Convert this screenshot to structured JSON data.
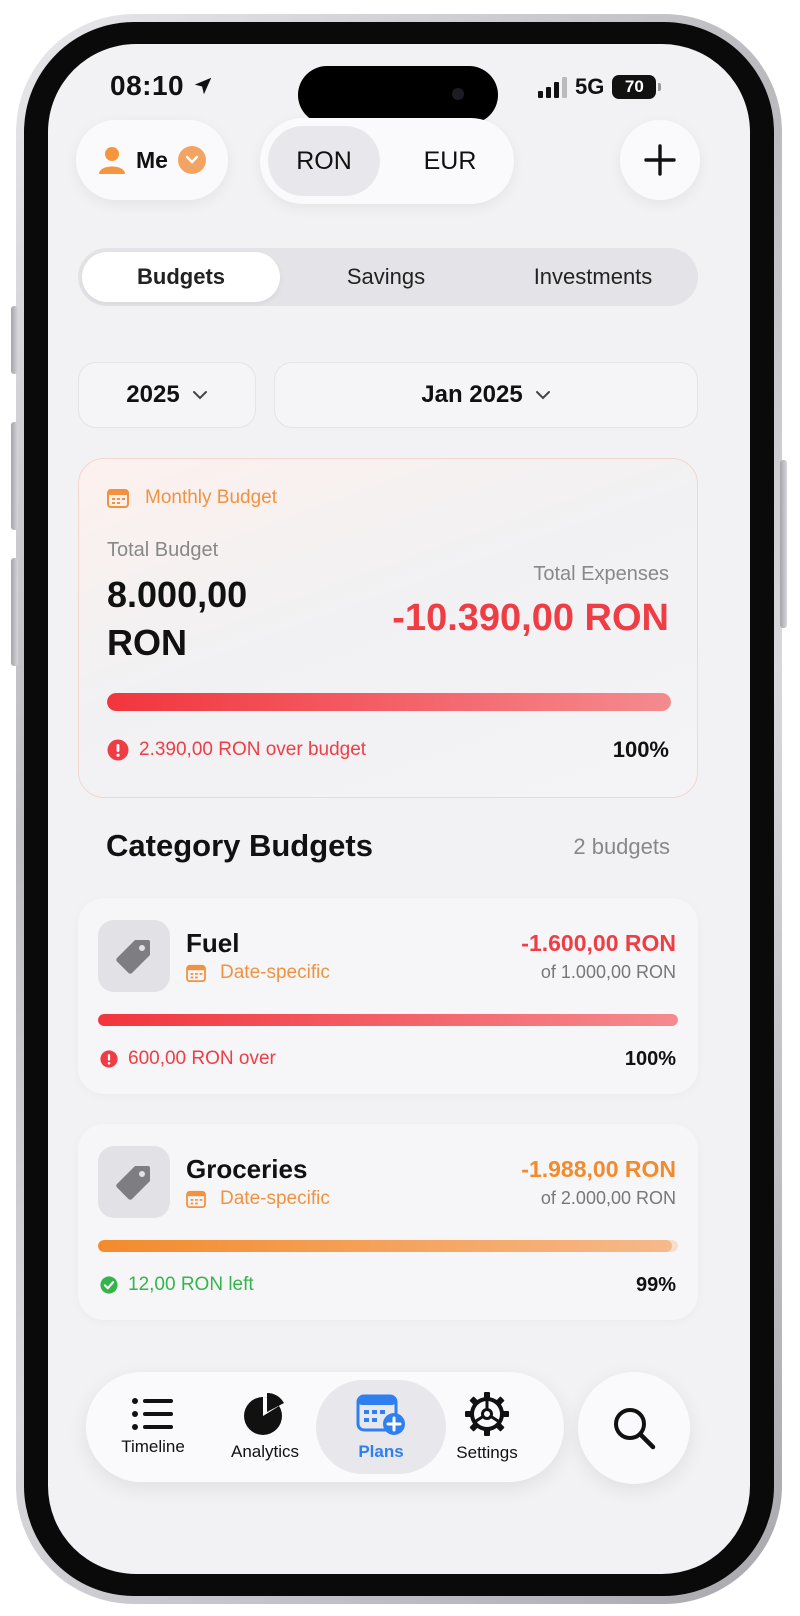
{
  "status_bar": {
    "time": "08:10",
    "network": "5G",
    "battery": "70"
  },
  "header": {
    "profile_label": "Me",
    "currencies": [
      "RON",
      "EUR"
    ],
    "selected_currency": "RON"
  },
  "tabs": [
    {
      "label": "Budgets",
      "active": true
    },
    {
      "label": "Savings",
      "active": false
    },
    {
      "label": "Investments",
      "active": false
    }
  ],
  "filters": {
    "year": "2025",
    "month": "Jan 2025"
  },
  "monthly_budget": {
    "title": "Monthly Budget",
    "total_budget_label": "Total Budget",
    "total_budget_line1": "8.000,00",
    "total_budget_line2": "RON",
    "total_expenses_label": "Total Expenses",
    "total_expenses": "-10.390,00 RON",
    "progress": 1.0,
    "status_text": "2.390,00 RON over budget",
    "percent": "100%"
  },
  "category_section": {
    "title": "Category Budgets",
    "count": "2 budgets"
  },
  "categories": [
    {
      "name": "Fuel",
      "type": "Date-specific",
      "spent": "-1.600,00 RON",
      "of": "of 1.000,00 RON",
      "progress": 1.0,
      "status_text": "600,00 RON over",
      "percent": "100%",
      "color": "#ef3d45",
      "status": "over"
    },
    {
      "name": "Groceries",
      "type": "Date-specific",
      "spent": "-1.988,00 RON",
      "of": "of 2.000,00 RON",
      "progress": 0.99,
      "status_text": "12,00 RON left",
      "percent": "99%",
      "color": "#f38b2c",
      "status": "ok"
    }
  ],
  "tab_bar": [
    {
      "label": "Timeline",
      "icon": "list-icon",
      "active": false
    },
    {
      "label": "Analytics",
      "icon": "pie-chart-icon",
      "active": false
    },
    {
      "label": "Plans",
      "icon": "calendar-plus-icon",
      "active": true
    },
    {
      "label": "Settings",
      "icon": "gear-icon",
      "active": false
    }
  ],
  "colors": {
    "accent": "#f0923f",
    "danger": "#ef3d45",
    "success": "#34b44a",
    "active_tab": "#2f7ff0"
  }
}
